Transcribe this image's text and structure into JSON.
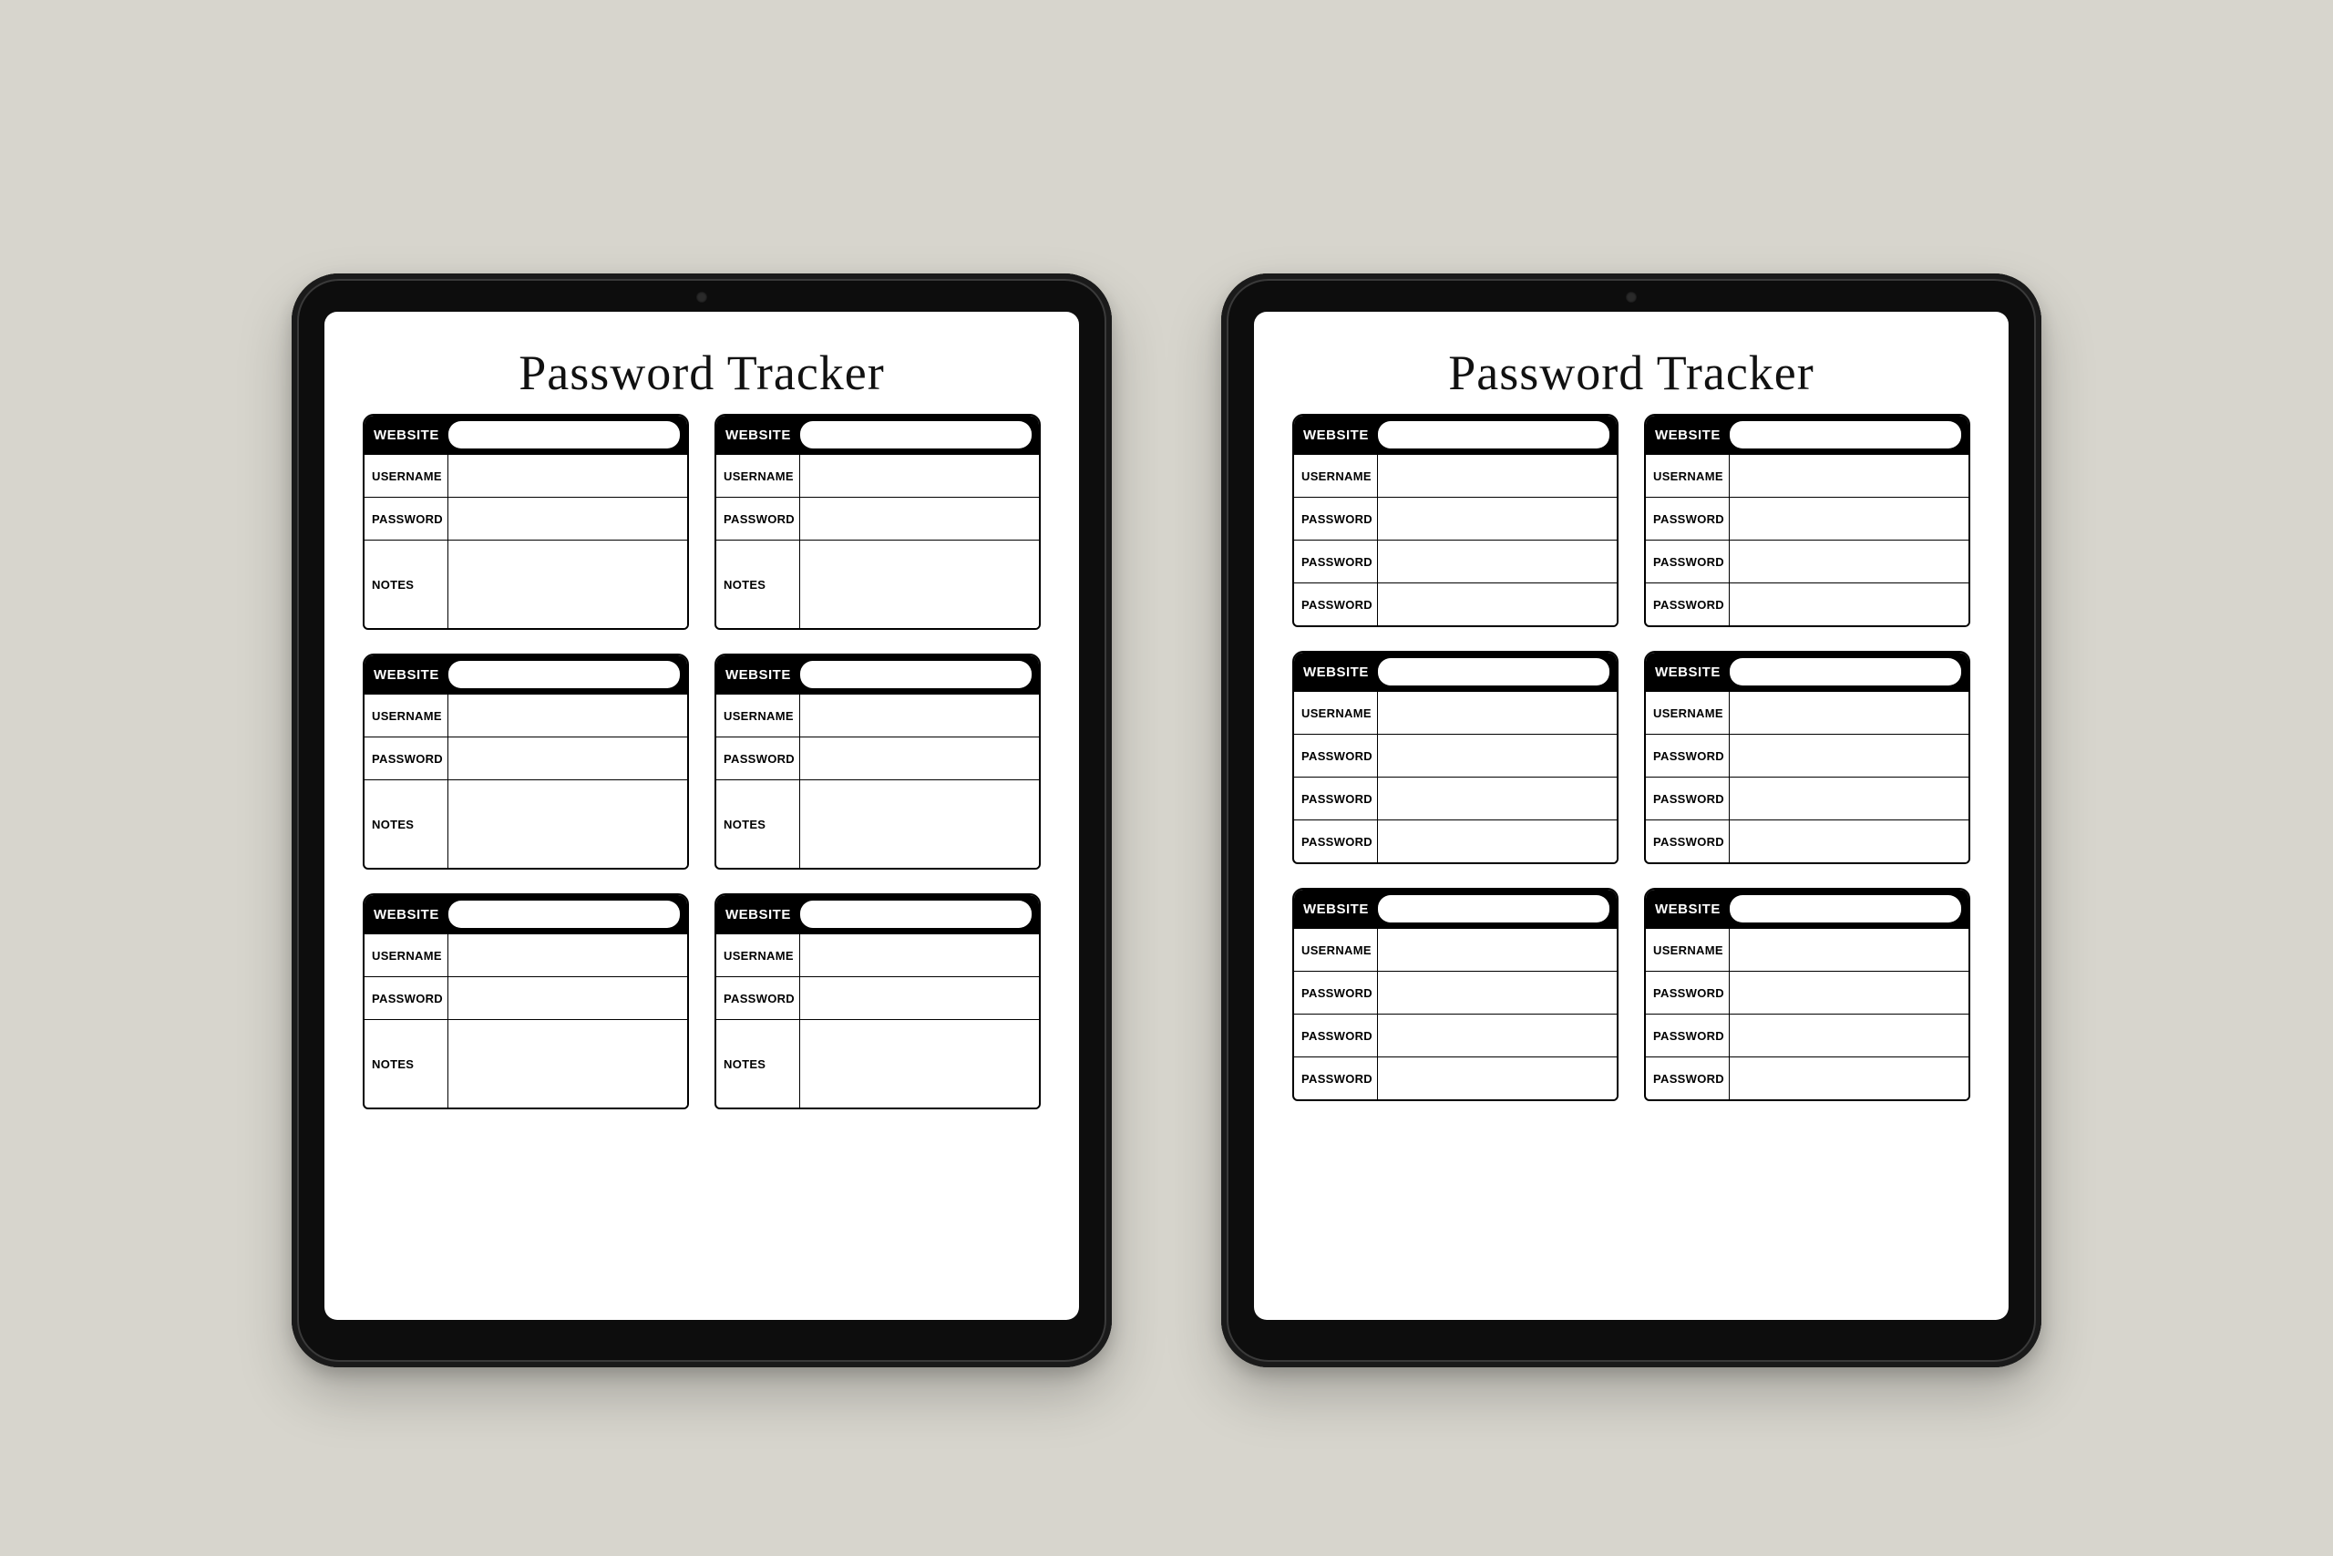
{
  "title": "Password Tracker",
  "labels": {
    "website": "WEBSITE",
    "username": "USERNAME",
    "password": "PASSWORD",
    "notes": "NOTES"
  },
  "tablets": [
    {
      "variant": "notes",
      "cards": 6,
      "card_rows": [
        "username",
        "password",
        "notes_large"
      ]
    },
    {
      "variant": "multi-password",
      "cards": 6,
      "card_rows": [
        "username",
        "password",
        "password",
        "password"
      ]
    }
  ]
}
